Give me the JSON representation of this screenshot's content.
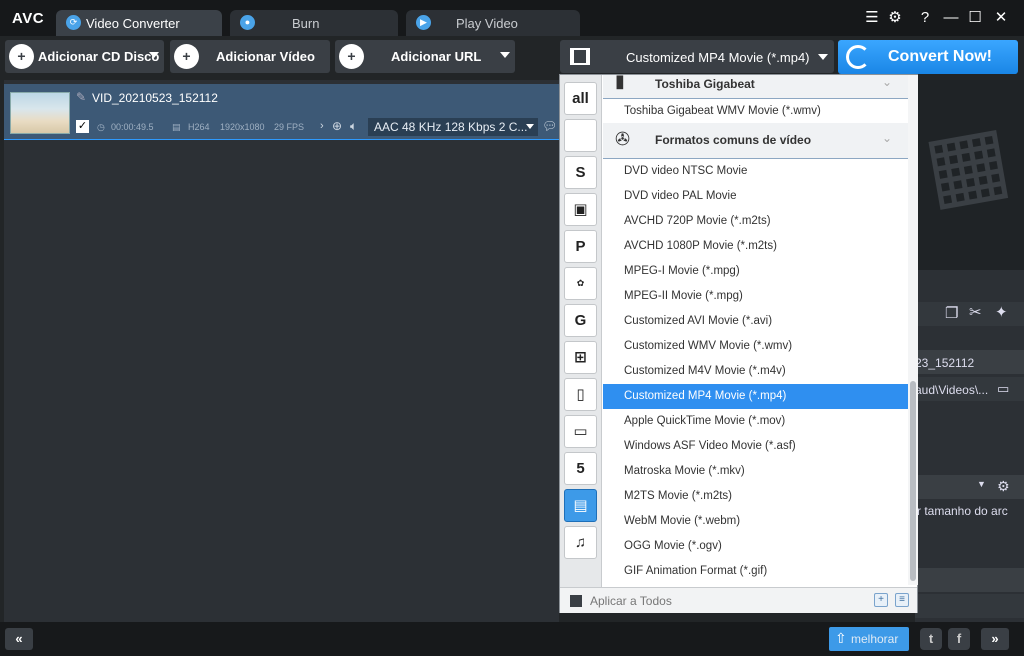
{
  "titlebar": {
    "logo": "AVC",
    "tabs": [
      {
        "label": "Video Converter",
        "icon": "refresh-icon"
      },
      {
        "label": "Burn",
        "icon": "disc-icon"
      },
      {
        "label": "Play Video",
        "icon": "play-icon"
      }
    ],
    "controls": {
      "menu": "☰",
      "settings": "⚙",
      "help": "?",
      "minimize": "—",
      "maximize": "☐",
      "close": "✕"
    }
  },
  "toolbar": {
    "add_cd_label": "Adicionar CD Disco",
    "add_video_label": "Adicionar Vídeo",
    "add_url_label": "Adicionar URL",
    "profile_label": "Customized MP4 Movie (*.mp4)",
    "convert_label": "Convert Now!"
  },
  "file": {
    "name": "VID_20210523_152112",
    "duration": "00:00:49.5",
    "codec": "H264",
    "resolution": "1920x1080",
    "fps": "29 FPS",
    "audio": "AAC 48 KHz 128 Kbps 2 C..."
  },
  "right_panel": {
    "filename_partial": "23_152112",
    "path_partial": "aud\\Videos\\...",
    "option_partial": "r tamanho do arc"
  },
  "categories": [
    {
      "label": "all",
      "icon": "all-icon"
    },
    {
      "label": "",
      "icon": "apple-icon"
    },
    {
      "label": "",
      "icon": "android-s-icon"
    },
    {
      "label": "",
      "icon": "android-icon"
    },
    {
      "label": "",
      "icon": "playstation-icon"
    },
    {
      "label": "",
      "icon": "huawei-icon"
    },
    {
      "label": "",
      "icon": "lg-icon"
    },
    {
      "label": "",
      "icon": "windows-icon"
    },
    {
      "label": "",
      "icon": "mobile-phone-icon"
    },
    {
      "label": "",
      "icon": "tv-icon"
    },
    {
      "label": "",
      "icon": "html5-icon"
    },
    {
      "label": "",
      "icon": "film-icon"
    },
    {
      "label": "",
      "icon": "music-icon"
    }
  ],
  "groups": {
    "toshiba": "Toshiba Gigabeat",
    "common": "Formatos comuns de vídeo"
  },
  "toshiba_items": [
    "Toshiba Gigabeat WMV Movie (*.wmv)"
  ],
  "formats": [
    "DVD video NTSC Movie",
    "DVD video PAL Movie",
    "AVCHD 720P Movie (*.m2ts)",
    "AVCHD 1080P Movie (*.m2ts)",
    "MPEG-I Movie (*.mpg)",
    "MPEG-II Movie (*.mpg)",
    "Customized AVI Movie (*.avi)",
    "Customized WMV Movie (*.wmv)",
    "Customized M4V Movie (*.m4v)",
    "Customized MP4 Movie (*.mp4)",
    "Apple QuickTime Movie (*.mov)",
    "Windows ASF Video Movie (*.asf)",
    "Matroska Movie (*.mkv)",
    "M2TS Movie (*.m2ts)",
    "WebM Movie (*.webm)",
    "OGG Movie (*.ogv)",
    "GIF Animation Format (*.gif)"
  ],
  "selected_format": "Customized MP4 Movie (*.mp4)",
  "footer": {
    "apply_all_label": "Aplicar a Todos"
  },
  "bottombar": {
    "upgrade_label": "melhorar",
    "prev": "«",
    "next": "»"
  },
  "colors": {
    "accent": "#2f8ff0",
    "convert": "#1a86e6",
    "file_row": "#3d5976"
  }
}
